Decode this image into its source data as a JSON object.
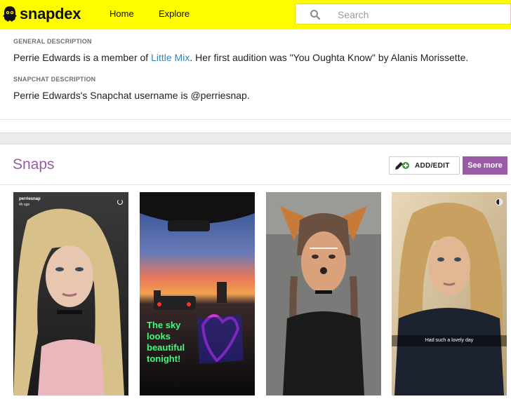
{
  "header": {
    "logo_text": "snapdex",
    "nav": {
      "home": "Home",
      "explore": "Explore"
    },
    "search": {
      "placeholder": "Search",
      "value": ""
    }
  },
  "general": {
    "heading": "GENERAL DESCRIPTION",
    "text_before": "Perrie Edwards is a member of ",
    "link": "Little Mix",
    "text_after": ". Her first audition was \"You Oughta Know\" by Alanis Morissette."
  },
  "snapchat": {
    "heading": "SNAPCHAT DESCRIPTION",
    "text": "Perrie Edwards's Snapchat username is @perriesnap."
  },
  "snaps": {
    "title": "Snaps",
    "add_edit_label": "ADD/EDIT",
    "see_more_label": "See more",
    "cards": [
      {
        "username": "perriesnap",
        "time": "4h ago"
      },
      {
        "overlay_text": "The sky\nlooks\nbeautiful\ntonight!"
      },
      {},
      {
        "caption": "Had such a lovely day"
      }
    ]
  },
  "colors": {
    "header_bg": "#fffc00",
    "accent_purple": "#9b5aa6",
    "link_blue": "#2e86c1"
  }
}
